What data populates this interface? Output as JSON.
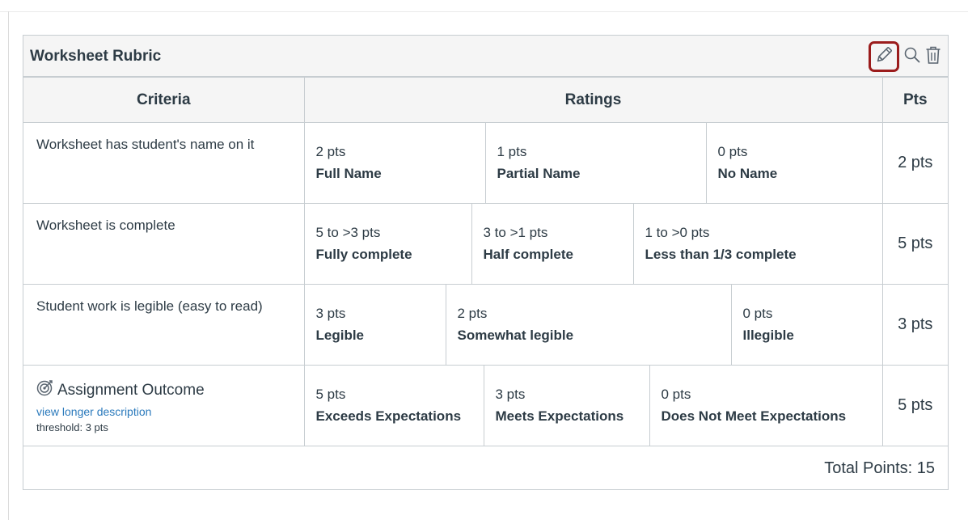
{
  "rubric": {
    "title": "Worksheet Rubric",
    "icons": {
      "edit": "pencil-icon",
      "search": "search-icon",
      "delete": "trash-icon"
    },
    "accent_color": "#9b1c1c",
    "link_color": "#2b7abc"
  },
  "columns": {
    "criteria": "Criteria",
    "ratings": "Ratings",
    "pts": "Pts"
  },
  "criteria": [
    {
      "description": "Worksheet has student's name on it",
      "ratings": [
        {
          "pts": "2 pts",
          "desc": "Full Name"
        },
        {
          "pts": "1 pts",
          "desc": "Partial Name"
        },
        {
          "pts": "0 pts",
          "desc": "No Name"
        }
      ],
      "points": "2 pts"
    },
    {
      "description": "Worksheet is complete",
      "ratings": [
        {
          "pts": "5 to >3 pts",
          "desc": "Fully complete"
        },
        {
          "pts": "3 to >1 pts",
          "desc": "Half complete"
        },
        {
          "pts": "1 to >0 pts",
          "desc": "Less than 1/3 complete"
        }
      ],
      "points": "5 pts"
    },
    {
      "description": "Student work is legible (easy to read)",
      "ratings": [
        {
          "pts": "3 pts",
          "desc": "Legible"
        },
        {
          "pts": "2 pts",
          "desc": "Somewhat legible"
        },
        {
          "pts": "0 pts",
          "desc": "Illegible"
        }
      ],
      "points": "3 pts"
    }
  ],
  "outcome": {
    "icon": "outcome-target-icon",
    "title": "Assignment Outcome",
    "link": "view longer description",
    "threshold": "threshold: 3 pts",
    "ratings": [
      {
        "pts": "5 pts",
        "desc": "Exceeds Expectations"
      },
      {
        "pts": "3 pts",
        "desc": "Meets Expectations"
      },
      {
        "pts": "0 pts",
        "desc": "Does Not Meet Expectations"
      }
    ],
    "points": "5 pts"
  },
  "total": "Total Points: 15"
}
